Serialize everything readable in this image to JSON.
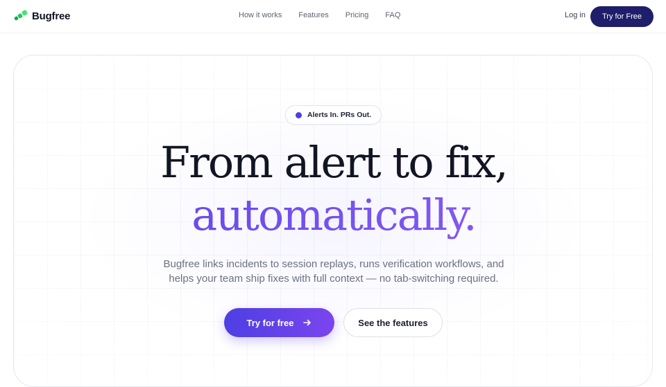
{
  "nav": {
    "brand": "Bugfree",
    "links": [
      "How it works",
      "Features",
      "Pricing",
      "FAQ"
    ],
    "login": "Log in",
    "cta": "Try for Free"
  },
  "hero": {
    "badge": "Alerts In. PRs Out.",
    "headline_line1": "From alert to fix,",
    "headline_line2": "automatically.",
    "subtitle_line1": "Bugfree links incidents to session replays, runs verification workflows, and",
    "subtitle_line2": "helps your team ship fixes with full context — no tab-switching required.",
    "primary_cta": "Try for free",
    "secondary_cta": "See the features"
  },
  "colors": {
    "brand_green": "#22c55e",
    "nav_cta_bg": "#1f1e6b",
    "accent": "#5b43e8"
  },
  "icons": {
    "logo": "bugfree-logo-icon",
    "cta_arrow": "arrow-right-icon"
  }
}
